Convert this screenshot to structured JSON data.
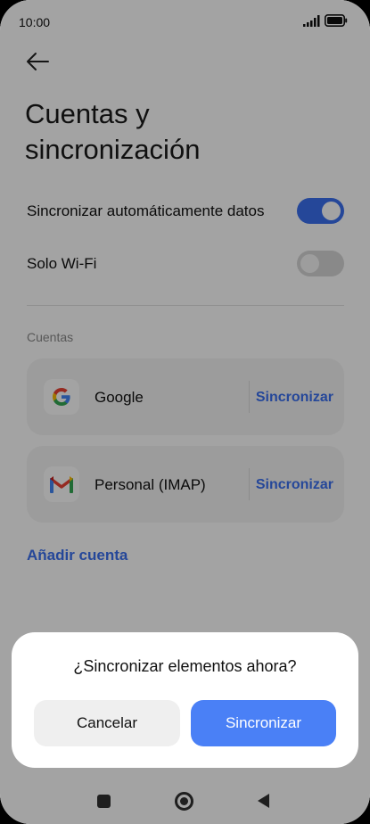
{
  "status_bar": {
    "time": "10:00"
  },
  "header": {
    "back_icon": "back-arrow-icon",
    "title_line1": "Cuentas y",
    "title_line2": "sincronización"
  },
  "settings": {
    "auto_sync": {
      "label": "Sincronizar automáticamente datos",
      "enabled": true
    },
    "wifi_only": {
      "label": "Solo Wi-Fi",
      "enabled": false
    }
  },
  "accounts": {
    "section_title": "Cuentas",
    "items": [
      {
        "name": "Google",
        "icon": "google-icon",
        "action": "Sincronizar"
      },
      {
        "name": "Personal (IMAP)",
        "icon": "gmail-icon",
        "action": "Sincronizar"
      }
    ],
    "add_account": "Añadir cuenta"
  },
  "dialog": {
    "question": "¿Sincronizar elementos ahora?",
    "cancel_label": "Cancelar",
    "confirm_label": "Sincronizar"
  },
  "colors": {
    "accent": "#3a6ff0",
    "confirm_button": "#4a80f6"
  },
  "nav": {
    "recents_icon": "square-icon",
    "home_icon": "circle-home-icon",
    "back_icon": "triangle-back-icon"
  }
}
